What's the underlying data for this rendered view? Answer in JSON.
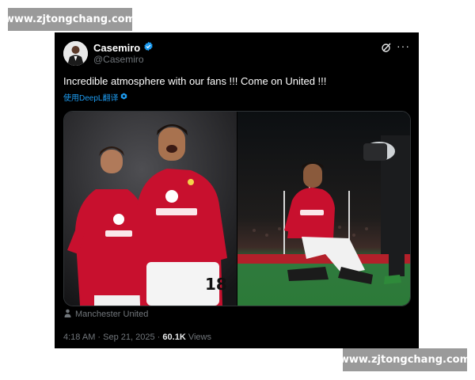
{
  "watermark": {
    "text": "www.zjtongchang.com"
  },
  "post": {
    "author_name": "Casemiro",
    "author_handle": "@Casemiro",
    "text": "Incredible atmosphere with our fans !!! Come on United !!!",
    "translate_label": "使用DeepL翻译",
    "location": "Manchester United",
    "time": "4:18 AM",
    "date": "Sep 21, 2025",
    "views_count": "60.1K",
    "views_label": "Views",
    "separator": "·"
  },
  "media": {
    "left_photo": {
      "players": [
        {
          "sponsor_word": "Snapdragon",
          "role": "player-left"
        },
        {
          "sponsor_word": "snapdragon",
          "shirt_number": "18",
          "role": "player-right"
        }
      ]
    },
    "right_photo": {
      "sponsor_word": "Snapdragon"
    }
  },
  "colors": {
    "card_bg": "#000000",
    "verified": "#1d9bf0",
    "link": "#1d9bf0",
    "muted": "#71767b",
    "kit_red": "#c8102e"
  },
  "icons": [
    "verified-badge-icon",
    "grok-icon",
    "more-options-icon",
    "translate-icon",
    "location-icon"
  ]
}
